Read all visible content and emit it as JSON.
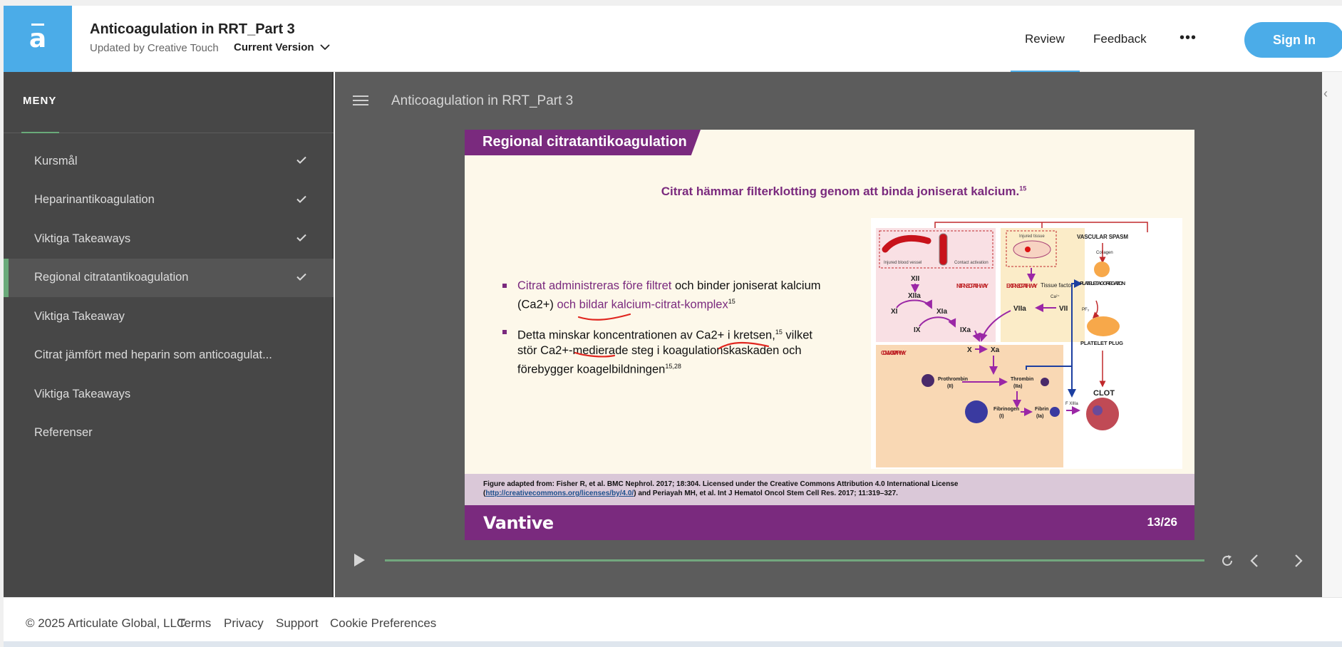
{
  "header": {
    "title": "Anticoagulation in RRT_Part 3",
    "subtitle": "Updated by Creative Touch",
    "version": "Current Version",
    "nav": {
      "review": "Review",
      "feedback": "Feedback",
      "more": "•••"
    },
    "signin": "Sign In",
    "accent_color": "#4bace8"
  },
  "sidebar": {
    "heading": "MENY",
    "items": [
      {
        "label": "Kursmål",
        "completed": true
      },
      {
        "label": "Heparinantikoagulation",
        "completed": true
      },
      {
        "label": "Viktiga Takeaways",
        "completed": true
      },
      {
        "label": "Regional citratantikoagulation",
        "completed": true,
        "active": true
      },
      {
        "label": "Viktiga Takeaway",
        "completed": false
      },
      {
        "label": "Citrat jämfört med heparin som anticoagulat...",
        "completed": false
      },
      {
        "label": "Viktiga Takeaways",
        "completed": false
      },
      {
        "label": "Referenser",
        "completed": false
      }
    ]
  },
  "player": {
    "title": "Anticoagulation in RRT_Part 3",
    "progress": 1.0
  },
  "slide": {
    "banner": "Regional citratantikoagulation",
    "heading": "Citrat hämmar filterklotting genom att binda joniserat kalcium.",
    "heading_ref": "15",
    "bullet1": {
      "part1": "Citrat administreras före filtret",
      "part2": " och binder joniserat kalcium (Ca2+) ",
      "part3": "och bildar kalcium-citrat-komplex",
      "ref": "15"
    },
    "bullet2": {
      "part1": "Detta minskar koncentrationen av Ca2+ i kretsen,",
      "ref1": "15",
      "part2": " vilket stör Ca2+-medierade steg i koagulationskaskaden och förebygger koagelbildningen",
      "ref2": "15,28"
    },
    "cascade": {
      "injured_vessel": "Injured blood vessel",
      "contact_activation": "Contact activation",
      "injured_tissue": "Injured tissue",
      "intrinsic": "INTRINSIC PATHWAY",
      "extrinsic": "EXTRINSIC PATHWAY",
      "vascular_spasm": "VASCULAR SPASM",
      "collagen": "Collagen",
      "platelet_aggregation": "PLATELET AGGREGATION",
      "pf3": "PF₃",
      "platelet_plug": "PLATELET PLUG",
      "clot": "CLOT",
      "common": "COMMON PATHWAY",
      "tissue_factor": "Tissue factor",
      "ca": "Ca²⁺",
      "xii": "XII",
      "xiia": "XIIa",
      "xi": "XI",
      "xia": "XIa",
      "ix": "IX",
      "ixa": "IXa",
      "viia": "VIIa",
      "vii": "VII",
      "x": "X",
      "xa": "Xa",
      "prothrombin": "Prothrombin",
      "prothrombin_num": "(II)",
      "thrombin": "Thrombin",
      "thrombin_num": "(IIa)",
      "fibrinogen": "Fibrinogen",
      "fibrinogen_num": "(I)",
      "fibrin": "Fibrin",
      "fibrin_num": "(Ia)",
      "f_xiiia": "F XIIIa"
    },
    "footnote_line1": "Figure adapted from: Fisher R, et al. BMC Nephrol. 2017; 18:304. Licensed under the Creative Commons Attribution 4.0 International License",
    "footnote_link": "http://creativecommons.org/licenses/by/4.0/",
    "footnote_line2_rest": " and Periayah MH, et al. Int J Hematol Oncol Stem Cell Res. 2017; 11:319–327.",
    "brand": "Vantive",
    "page": "13/26"
  },
  "footer": {
    "copyright": "© 2025 Articulate Global, LLC",
    "terms": "Terms",
    "privacy": "Privacy",
    "support": "Support",
    "cookies": "Cookie Preferences"
  }
}
